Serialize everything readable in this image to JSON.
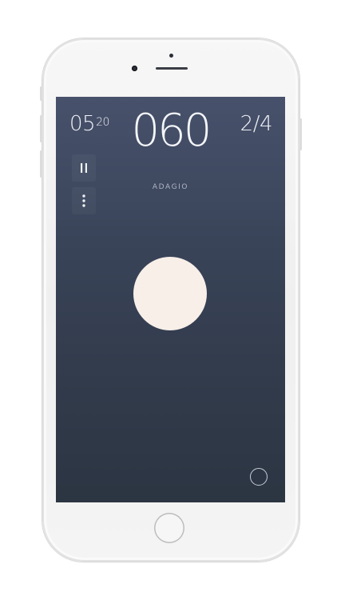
{
  "header": {
    "timer_main": "05",
    "timer_sup": "20",
    "tempo_bpm": "060",
    "time_signature": "2/4"
  },
  "tempo_name": "ADAGIO",
  "icons": {
    "pause": "pause-icon",
    "more": "more-vertical-icon",
    "beat": "beat-circle",
    "settings": "ring-icon",
    "home": "home-button"
  },
  "colors": {
    "screen_top": "#47516b",
    "screen_bottom": "#2c3542",
    "beat_circle": "#f8efe9",
    "text": "#eef1f6"
  }
}
